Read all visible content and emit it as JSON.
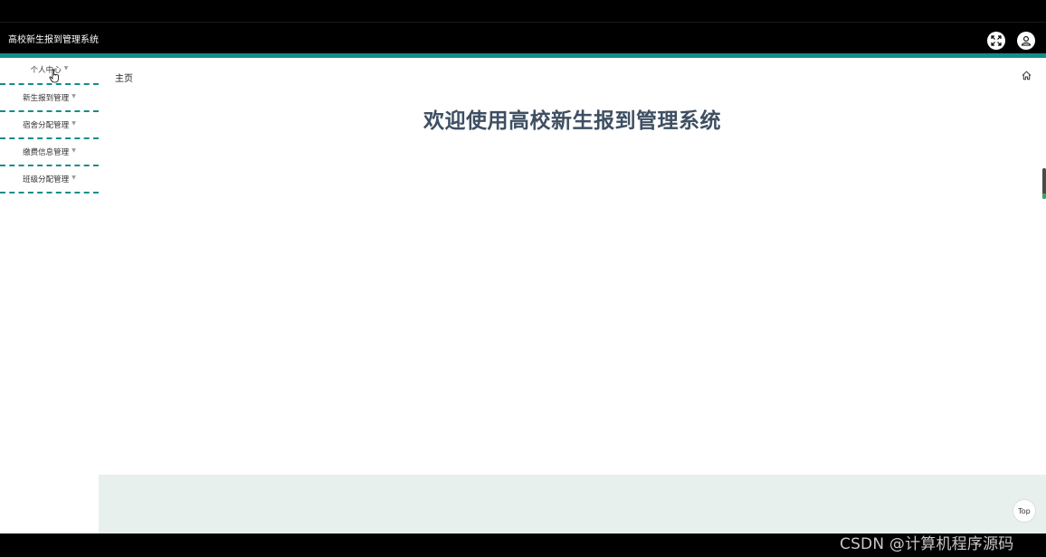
{
  "header": {
    "app_title": "高校新生报到管理系统",
    "fullscreen_icon": "fullscreen-icon",
    "user_icon": "user-icon"
  },
  "sidebar": {
    "items": [
      {
        "label": "个人中心"
      },
      {
        "label": "新生报到管理"
      },
      {
        "label": "宿舍分配管理"
      },
      {
        "label": "缴费信息管理"
      },
      {
        "label": "班级分配管理"
      }
    ]
  },
  "main": {
    "breadcrumb": "主页",
    "welcome_text": "欢迎使用高校新生报到管理系统",
    "top_button_label": "Top"
  },
  "watermark": "CSDN @计算机程序源码",
  "colors": {
    "accent": "#138d8a",
    "welcome_text": "#3e4f62",
    "footer_bg": "#e8f0ee"
  }
}
